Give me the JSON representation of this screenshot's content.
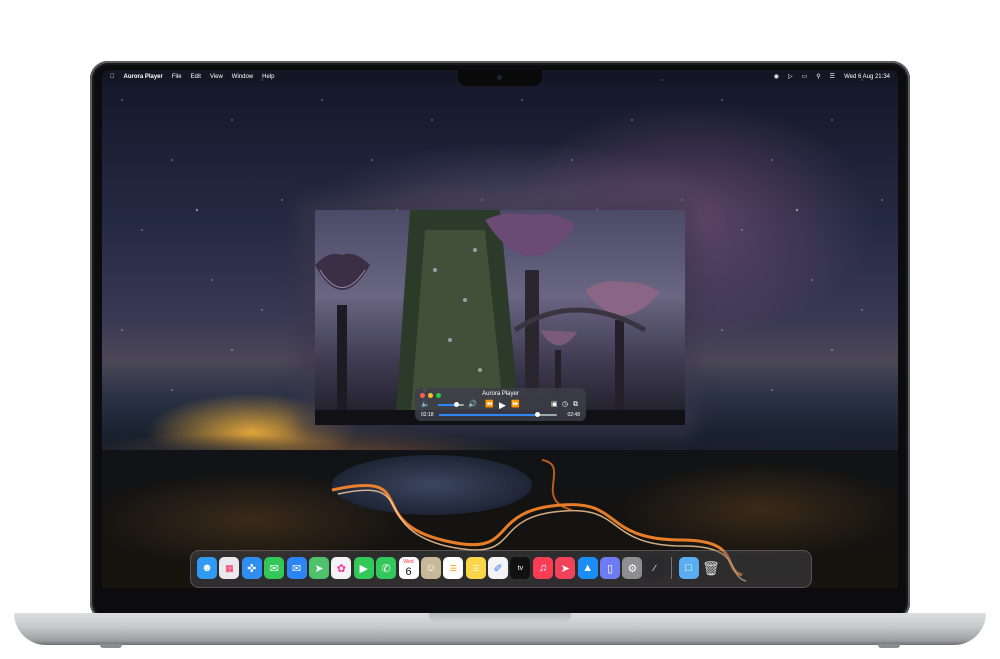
{
  "menu_bar": {
    "apple_icon": "apple-icon",
    "app_name": "Aurora Player",
    "items": [
      "File",
      "Edit",
      "View",
      "Window",
      "Help"
    ],
    "status_icons": [
      "screen-record-icon",
      "play-icon",
      "battery-icon",
      "search-icon",
      "control-center-icon"
    ],
    "datetime": "Wed 6 Aug 21:34"
  },
  "player": {
    "title": "Aurora Player",
    "elapsed": "02:18",
    "remaining": "02:48",
    "progress_percent": 83,
    "volume_percent": 70,
    "controls": {
      "volume_icon": "volume-icon",
      "rewind_icon": "rewind-icon",
      "play_icon": "play-icon",
      "forward_icon": "fast-forward-icon",
      "airplay_icon": "airplay-icon",
      "speed_icon": "speed-icon",
      "pip_icon": "picture-in-picture-icon"
    }
  },
  "dock": {
    "calendar_month": "Wed",
    "calendar_day": "6",
    "apple_tv_label": "tv",
    "apps": [
      {
        "name": "Finder",
        "icon": "finder-icon",
        "color": "#2f9bf5"
      },
      {
        "name": "Launchpad",
        "icon": "launchpad-icon",
        "color": "#e9e9ee"
      },
      {
        "name": "Safari",
        "icon": "safari-icon",
        "color": "#2f8ef0"
      },
      {
        "name": "Messages",
        "icon": "messages-icon",
        "color": "#33c759"
      },
      {
        "name": "Mail",
        "icon": "mail-icon",
        "color": "#2e84f0"
      },
      {
        "name": "Maps",
        "icon": "maps-icon",
        "color": "#4ec26a"
      },
      {
        "name": "Photos",
        "icon": "photos-icon",
        "color": "#f4f4f6"
      },
      {
        "name": "FaceTime",
        "icon": "facetime-icon",
        "color": "#34c759"
      },
      {
        "name": "Phone",
        "icon": "phone-icon",
        "color": "#34c759"
      },
      {
        "name": "Calendar",
        "icon": "calendar-icon",
        "color": "#ffffff"
      },
      {
        "name": "Contacts",
        "icon": "contacts-icon",
        "color": "#c9b89a"
      },
      {
        "name": "Reminders",
        "icon": "reminders-icon",
        "color": "#ffffff"
      },
      {
        "name": "Notes",
        "icon": "notes-icon",
        "color": "#f9d648"
      },
      {
        "name": "Freeform",
        "icon": "freeform-icon",
        "color": "#f4f4f6"
      },
      {
        "name": "Apple TV",
        "icon": "apple-tv-icon",
        "color": "#111111"
      },
      {
        "name": "Music",
        "icon": "music-icon",
        "color": "#fa3c55"
      },
      {
        "name": "Rocket Typist",
        "icon": "rocket-icon",
        "color": "#f0435a"
      },
      {
        "name": "App Store",
        "icon": "app-store-icon",
        "color": "#1c8cf6"
      },
      {
        "name": "Simulator",
        "icon": "simulator-icon",
        "color": "#6d7cf0"
      },
      {
        "name": "System Settings",
        "icon": "settings-icon",
        "color": "#8e8e93"
      },
      {
        "name": "Script Editor",
        "icon": "script-icon",
        "color": "#2a2a2e"
      }
    ],
    "folder_icon": "downloads-folder-icon",
    "trash_icon": "trash-icon"
  }
}
